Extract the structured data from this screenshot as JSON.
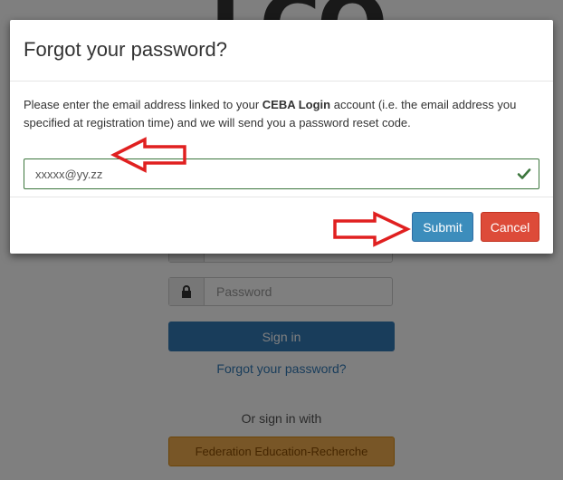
{
  "background": {
    "logo_text": "LCO",
    "password_placeholder": "Password",
    "signin_label": "Sign in",
    "forgot_link": "Forgot your password?",
    "or_text": "Or sign in with",
    "federation_label": "Federation Education-Recherche"
  },
  "modal": {
    "title": "Forgot your password?",
    "desc_prefix": "Please enter the email address linked to your ",
    "desc_bold": "CEBA Login",
    "desc_suffix": " account (i.e. the email address you specified at registration time) and we will send you a password reset code.",
    "email_value": "xxxxx@yy.zz",
    "submit_label": "Submit",
    "cancel_label": "Cancel"
  },
  "colors": {
    "submit": "#3c8dbc",
    "cancel": "#dd4b39",
    "valid_border": "#3c763d",
    "annotation_arrow": "#e02020"
  },
  "icons": {
    "lock": "lock-icon",
    "check": "check-icon",
    "arrow": "annotation-arrow-icon"
  }
}
